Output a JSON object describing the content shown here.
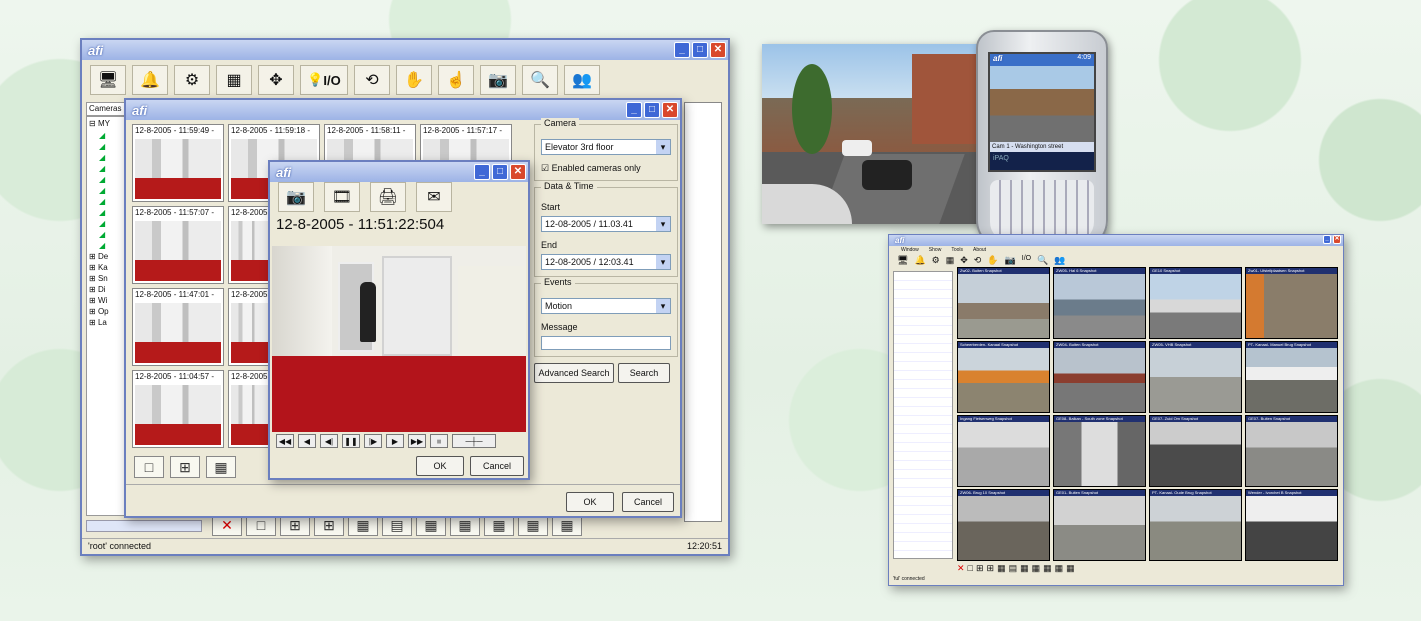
{
  "main_window": {
    "logo": "afi",
    "tab_cameras": "Cameras",
    "tree_root": "MY",
    "tree_items": [
      "De",
      "Ka",
      "Sn",
      "Di",
      "Wi",
      "Op",
      "La"
    ],
    "status": "'root' connected",
    "clock": "12:20:51",
    "toolbar_io": "I/O"
  },
  "search_window": {
    "logo": "afi",
    "thumbs": [
      "12-8-2005 - 11:59:49 -",
      "12-8-2005 - 11:59:18 -",
      "12-8-2005 - 11:58:11 -",
      "12-8-2005 - 11:57:17 -",
      "12-8-2005 - 11:57:07 -",
      "12-8-2005",
      "12-8-2005 - 11:47:01 -",
      "12-8-2005",
      "12-8-2005 - 11:04:57 -",
      "12-8-2005"
    ],
    "camera_label": "Camera",
    "camera_value": "Elevator 3rd floor",
    "enabled_only": "Enabled cameras only",
    "datetime_label": "Data & Time",
    "start_label": "Start",
    "start_value": "12-08-2005 / 11.03.41",
    "end_label": "End",
    "end_value": "12-08-2005 / 12:03.41",
    "events_label": "Events",
    "events_value": "Motion",
    "message_label": "Message",
    "adv_search": "Advanced Search",
    "search": "Search",
    "ok": "OK",
    "cancel": "Cancel"
  },
  "playback_window": {
    "logo": "afi",
    "timestamp": "12-8-2005 - 11:51:22:504",
    "ok": "OK",
    "cancel": "Cancel"
  },
  "pda": {
    "logo": "afi",
    "status": "4:09",
    "caption": "Cam 1 - Washington street",
    "brand": "iPAQ"
  },
  "grid_window": {
    "logo": "afi",
    "menu": [
      "Window",
      "Show",
      "Tools",
      "About"
    ],
    "status": "'ful' connected",
    "io": "I/O",
    "cells": [
      "Zw02- Buiten Snapshot",
      "ZW05- Hal 6 Snapshot",
      "GE10 Snapshot",
      "Zw01- Ufstellplaatsen Snapshot",
      "Scheerberden- Kanaal Snapshot",
      "ZW04- Buiten Snapshot",
      "ZW05- VHB Snapshot",
      "PT- Kanaal- Manuel Brug Snapshot",
      "Ingang Fietsenweg Snapshot",
      "GE08- Balkan - South zone Snapshot",
      "GE07- Zuid Om Snapshot",
      "GE07- Buiten Snapshot",
      "ZW06- Brug 10 Snapshot",
      "GE01- Buiten Snapshot",
      "PT- Kanaal- Oude Brug Snapshot",
      "Wender - Ivorchet B Snapshot"
    ]
  }
}
